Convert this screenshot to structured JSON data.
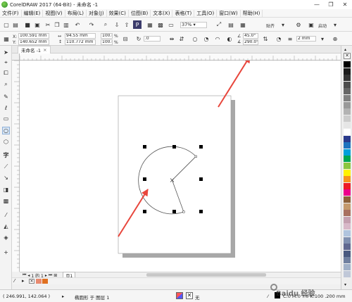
{
  "window": {
    "title": "CorelDRAW 2017 (64-Bit) - 未命名 -1",
    "minimize": "—",
    "restore": "❐",
    "close": "✕"
  },
  "menu": [
    "文件(F)",
    "编辑(E)",
    "视图(V)",
    "布局(L)",
    "对象(J)",
    "效果(C)",
    "位图(B)",
    "文本(X)",
    "表格(T)",
    "工具(O)",
    "窗口(W)",
    "帮助(H)"
  ],
  "standard_toolbar": {
    "zoom": "37%",
    "snap_label": "贴齐",
    "launch_label": "启动"
  },
  "property_bar": {
    "x_label": "X:",
    "x_value": "100.591 mm",
    "y_label": "Y:",
    "y_value": "140.652 mm",
    "width_value": "94.55 mm",
    "height_value": "110.772 mm",
    "scale_x": "100.0",
    "scale_y": "100.0",
    "scale_unit": "%",
    "rotation": ".0",
    "start_angle": "45.0",
    "end_angle": "290.0",
    "degree_unit": "°",
    "outline_width": "2 mm"
  },
  "document_tab": {
    "name": "未命名 -1",
    "close": "×"
  },
  "page_nav": {
    "counter": "1 的 1",
    "page_tab": "页1"
  },
  "colors": {
    "accent": "#1e73be",
    "arrow": "#e8463c",
    "fill_swatch": "#e88a70",
    "outline_swatch": "#e07020"
  },
  "palette": [
    "#000000",
    "#1a1a1a",
    "#333333",
    "#4d4d4d",
    "#666666",
    "#808080",
    "#999999",
    "#b3b3b3",
    "#cccccc",
    "#e6e6e6",
    "#ffffff",
    "#2a3a8c",
    "#1e73be",
    "#00a0dc",
    "#00a651",
    "#8dc63f",
    "#fff200",
    "#f7941d",
    "#ed1c24",
    "#ec008c",
    "#8c6239",
    "#c49a6c",
    "#a87060",
    "#c4a0b0",
    "#d8b8c8",
    "#b0c4de",
    "#8090b0",
    "#606890",
    "#4a5a80",
    "#7080a0",
    "#a0b0c8",
    "#c0c8d8"
  ],
  "status": {
    "coords": "( 246.991, 142.064 )",
    "selection": "椭圆形 于 图层 1",
    "fill_none": "无",
    "color_info": "C:0 M:0 Y:0 K:100  .200 mm"
  },
  "watermark": "Baidu 经验"
}
